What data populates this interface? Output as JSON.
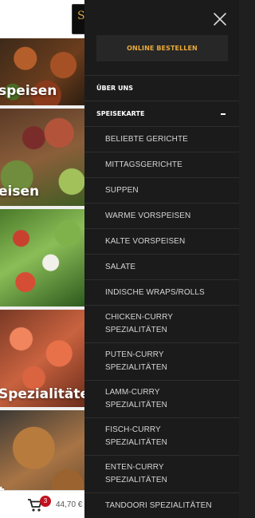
{
  "background": {
    "logo_letter": "S",
    "tiles": [
      {
        "label": "speisen"
      },
      {
        "label": "eisen"
      },
      {
        "label": ""
      },
      {
        "label": "Spezialitäten"
      },
      {
        "label": "t"
      }
    ],
    "cart": {
      "count": "3",
      "total": "44,70 €"
    }
  },
  "drawer": {
    "order_button": "ONLINE BESTELLEN",
    "menu": [
      {
        "label": "ÜBER UNS"
      },
      {
        "label": "SPEISEKARTE",
        "toggle": "–"
      }
    ],
    "submenu": [
      {
        "label": "BELIEBTE GERICHTE"
      },
      {
        "label": "MITTAGSGERICHTE"
      },
      {
        "label": "SUPPEN"
      },
      {
        "label": "WARME VORSPEISEN"
      },
      {
        "label": "KALTE VORSPEISEN"
      },
      {
        "label": "SALATE"
      },
      {
        "label": "INDISCHE WRAPS/ROLLS"
      },
      {
        "line1": "CHICKEN-CURRY",
        "line2": "SPEZIALITÄTEN"
      },
      {
        "line1": "PUTEN-CURRY",
        "line2": "SPEZIALITÄTEN"
      },
      {
        "line1": "LAMM-CURRY",
        "line2": "SPEZIALITÄTEN"
      },
      {
        "line1": "FISCH-CURRY",
        "line2": "SPEZIALITÄTEN"
      },
      {
        "line1": "ENTEN-CURRY",
        "line2": "SPEZIALITÄTEN"
      },
      {
        "label": "TANDOORI SPEZIALITÄTEN"
      }
    ]
  },
  "colors": {
    "drawer_bg": "#1b1b1b",
    "accent": "#e8a93a",
    "badge": "#c0121e"
  }
}
